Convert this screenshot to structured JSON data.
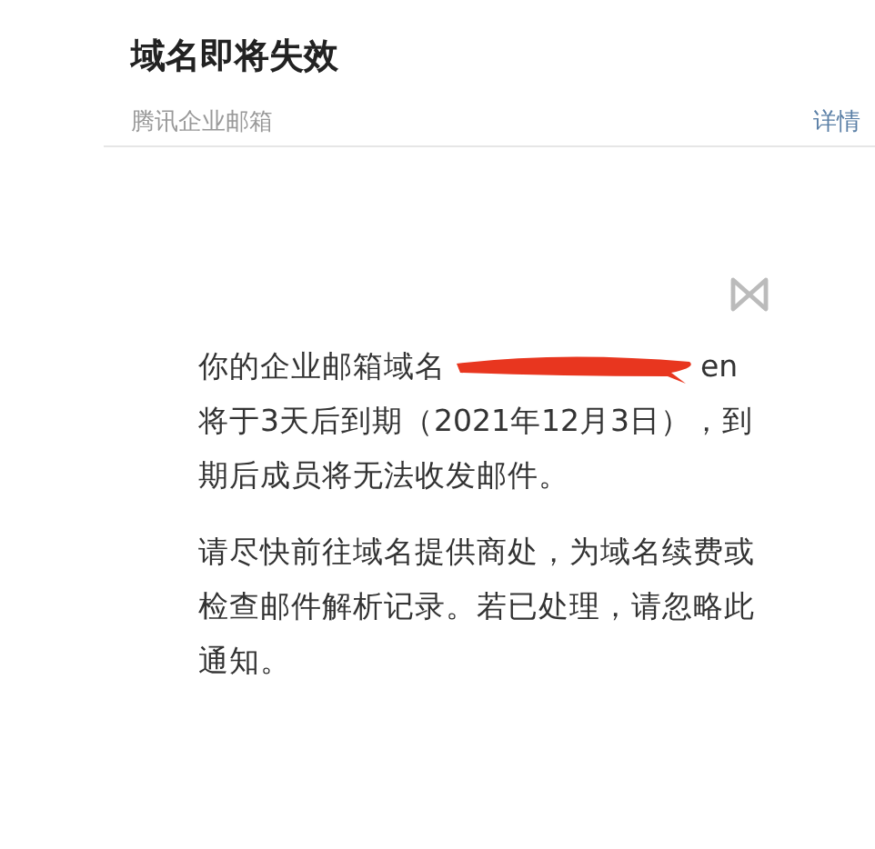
{
  "header": {
    "title": "域名即将失效",
    "sender": "腾讯企业邮箱",
    "details_link": "详情"
  },
  "body": {
    "paragraphs": [
      {
        "before_redaction": "你的企业邮箱域名",
        "after_redaction": "en 将于3天后到期（2021年12月3日），到期后成员将无法收发邮件。",
        "redacted": true
      },
      {
        "before_redaction": "请尽快前往域名提供商处，为域名续费或检查邮件解析记录。若已处理，请忽略此通知。",
        "redacted": false
      }
    ]
  }
}
